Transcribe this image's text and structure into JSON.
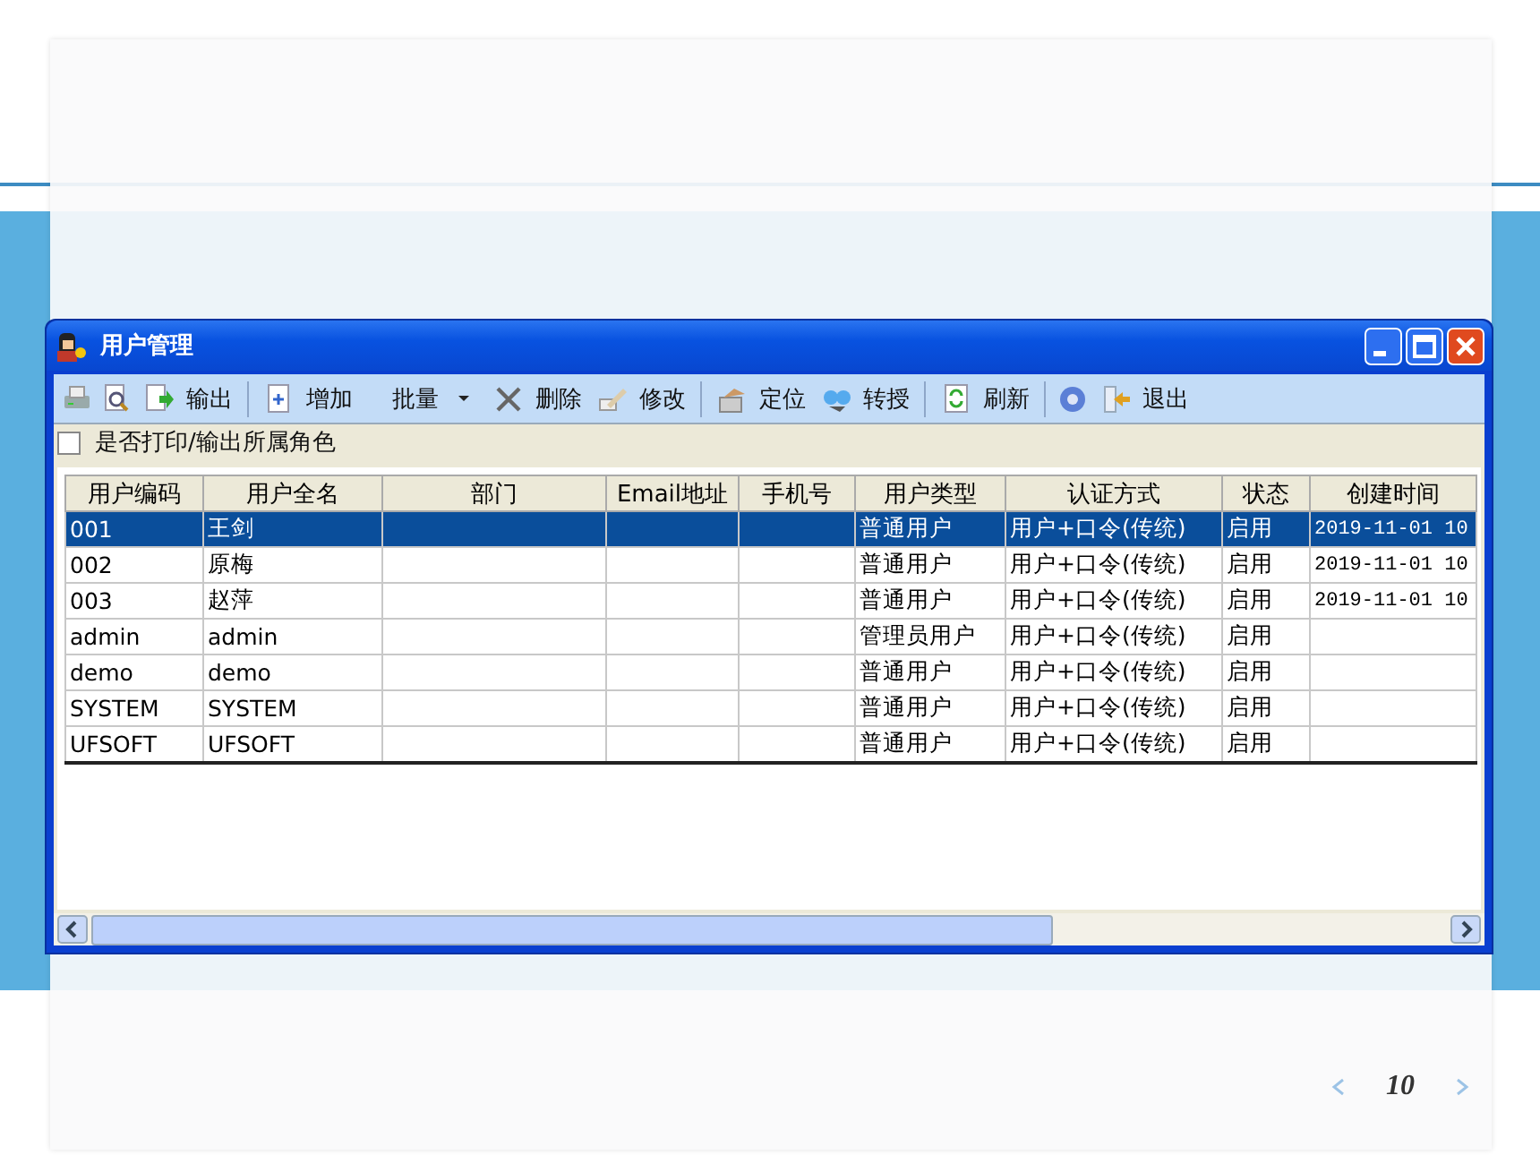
{
  "window": {
    "title": "用户管理"
  },
  "toolbar": [
    {
      "kind": "icon"
    },
    {
      "kind": "icon"
    },
    {
      "kind": "button",
      "label": "输出"
    },
    {
      "kind": "separator"
    },
    {
      "kind": "button",
      "label": "增加"
    },
    {
      "kind": "menu",
      "label": "批量"
    },
    {
      "kind": "button",
      "label": "删除"
    },
    {
      "kind": "button",
      "label": "修改"
    },
    {
      "kind": "separator"
    },
    {
      "kind": "button",
      "label": "定位"
    },
    {
      "kind": "button",
      "label": "转授"
    },
    {
      "kind": "separator"
    },
    {
      "kind": "button",
      "label": "刷新"
    },
    {
      "kind": "separator"
    },
    {
      "kind": "icon"
    },
    {
      "kind": "button",
      "label": "退出"
    }
  ],
  "option": {
    "label": "是否打印/输出所属角色",
    "checked": false
  },
  "table": {
    "columns": [
      "用户编码",
      "用户全名",
      "部门",
      "Email地址",
      "手机号",
      "用户类型",
      "认证方式",
      "状态",
      "创建时间"
    ],
    "rows": [
      {
        "selected": true,
        "cells": [
          "001",
          "王剑",
          "",
          "",
          "",
          "普通用户",
          "用户+口令(传统)",
          "启用",
          "2019-11-01 10"
        ]
      },
      {
        "selected": false,
        "cells": [
          "002",
          "原梅",
          "",
          "",
          "",
          "普通用户",
          "用户+口令(传统)",
          "启用",
          "2019-11-01 10"
        ]
      },
      {
        "selected": false,
        "cells": [
          "003",
          "赵萍",
          "",
          "",
          "",
          "普通用户",
          "用户+口令(传统)",
          "启用",
          "2019-11-01 10"
        ]
      },
      {
        "selected": false,
        "cells": [
          "admin",
          "admin",
          "",
          "",
          "",
          "管理员用户",
          "用户+口令(传统)",
          "启用",
          ""
        ]
      },
      {
        "selected": false,
        "cells": [
          "demo",
          "demo",
          "",
          "",
          "",
          "普通用户",
          "用户+口令(传统)",
          "启用",
          ""
        ]
      },
      {
        "selected": false,
        "cells": [
          "SYSTEM",
          "SYSTEM",
          "",
          "",
          "",
          "普通用户",
          "用户+口令(传统)",
          "启用",
          ""
        ]
      },
      {
        "selected": false,
        "cells": [
          "UFSOFT",
          "UFSOFT",
          "",
          "",
          "",
          "普通用户",
          "用户+口令(传统)",
          "启用",
          ""
        ]
      }
    ]
  },
  "slide": {
    "page_number": "10"
  }
}
